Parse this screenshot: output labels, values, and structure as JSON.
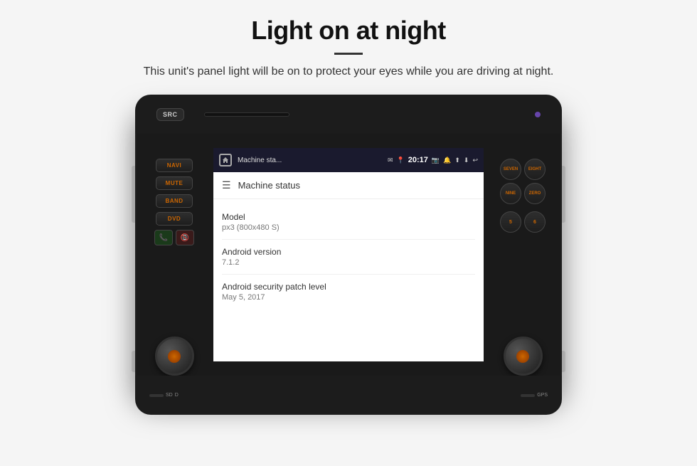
{
  "header": {
    "title": "Light on at night",
    "subtitle": "This unit's panel light will be on to protect your eyes while you are driving at night."
  },
  "unit": {
    "buttons": {
      "src": "SRC",
      "navi": "NAVI",
      "mute": "MUTE",
      "band": "BAND",
      "dvd": "DVD",
      "seven": "SEVEN",
      "eight": "EIGHT",
      "nine": "NINE",
      "zero": "ZERO"
    },
    "bottom": {
      "sd": "SD",
      "d": "D",
      "gps": "GPS"
    }
  },
  "android": {
    "status_bar": {
      "app_name": "Machine sta...",
      "time": "20:17",
      "extra": "..."
    },
    "toolbar": {
      "title": "Machine status"
    },
    "info_items": [
      {
        "label": "Model",
        "value": "px3 (800x480 S)"
      },
      {
        "label": "Android version",
        "value": "7.1.2"
      },
      {
        "label": "Android security patch level",
        "value": "May 5, 2017"
      }
    ]
  }
}
